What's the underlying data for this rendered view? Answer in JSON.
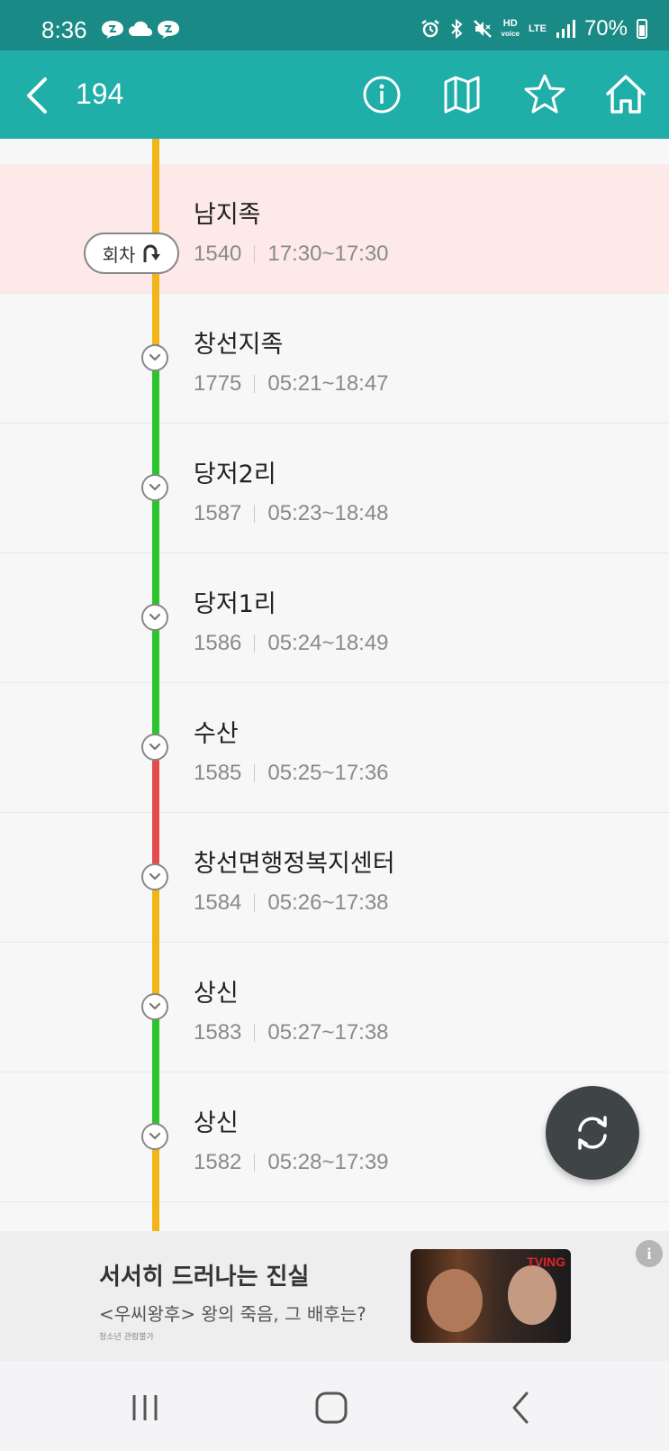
{
  "status_bar": {
    "time": "8:36",
    "battery_percent": "70%",
    "hd_label": "HD",
    "voice_label": "voice",
    "lte_label": "LTE",
    "icons": [
      "chat-icon",
      "cloud-icon",
      "chat-icon",
      "alarm-icon",
      "bluetooth-icon",
      "mute-icon",
      "signal-icon",
      "battery-icon"
    ]
  },
  "app_bar": {
    "title": "194",
    "actions": [
      "info-icon",
      "map-icon",
      "star-icon",
      "home-icon"
    ]
  },
  "turnaround_label": "회차",
  "stops": [
    {
      "name": "남지족",
      "id": "1540",
      "hours": "17:30~17:30",
      "highlight": true
    },
    {
      "name": "창선지족",
      "id": "1775",
      "hours": "05:21~18:47"
    },
    {
      "name": "당저2리",
      "id": "1587",
      "hours": "05:23~18:48"
    },
    {
      "name": "당저1리",
      "id": "1586",
      "hours": "05:24~18:49"
    },
    {
      "name": "수산",
      "id": "1585",
      "hours": "05:25~17:36"
    },
    {
      "name": "창선면행정복지센터",
      "id": "1584",
      "hours": "05:26~17:38"
    },
    {
      "name": "상신",
      "id": "1583",
      "hours": "05:27~17:38"
    },
    {
      "name": "상신",
      "id": "1582",
      "hours": "05:28~17:39"
    }
  ],
  "line_colors": {
    "yellow": "#f2b417",
    "green": "#2cc42c",
    "red": "#e54b4b"
  },
  "ad": {
    "title": "서서히 드러나는 진실",
    "subtitle": "<우씨왕후> 왕의 죽음, 그 배후는?",
    "rating": "청소년 관람불가",
    "brand": "TVING",
    "info_label": "i"
  },
  "nav_bar": [
    "recent-apps-icon",
    "home-nav-icon",
    "back-nav-icon"
  ],
  "colors": {
    "status_bar": "#1a8a86",
    "app_bar": "#20aea9",
    "highlight_row": "#fde9e7",
    "fab": "#3f4447"
  }
}
